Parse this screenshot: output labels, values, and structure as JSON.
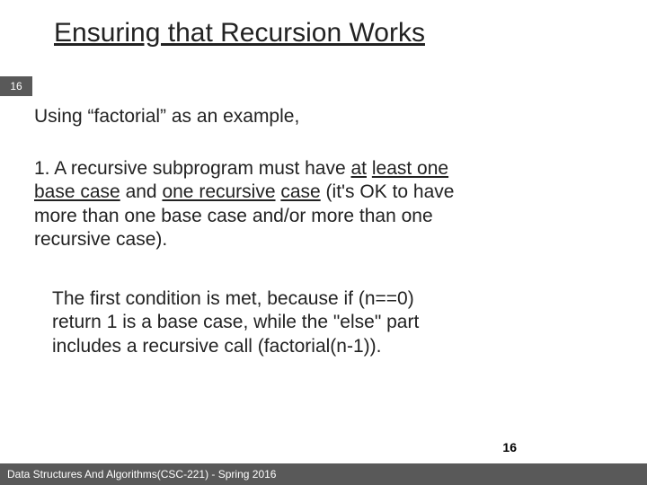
{
  "title": "Ensuring that Recursion Works",
  "sideTag": "16",
  "intro": "Using “factorial” as an example,",
  "point1": {
    "prefix": "1.  A recursive subprogram must have ",
    "u1": "at",
    "nl1": " ",
    "u2": "least one base case",
    "mid": " and ",
    "u3": "one recursive",
    "nl2": " ",
    "u4": "case",
    "suffix": " (it's OK to have more than one base case and/or more than one recursive case)."
  },
  "explain": "The first condition is met, because if (n==0) return 1 is a base case, while the \"else\" part includes a recursive call (factorial(n-1)).",
  "pageNumber": "16",
  "footer": "Data Structures And Algorithms(CSC-221) - Spring 2016"
}
